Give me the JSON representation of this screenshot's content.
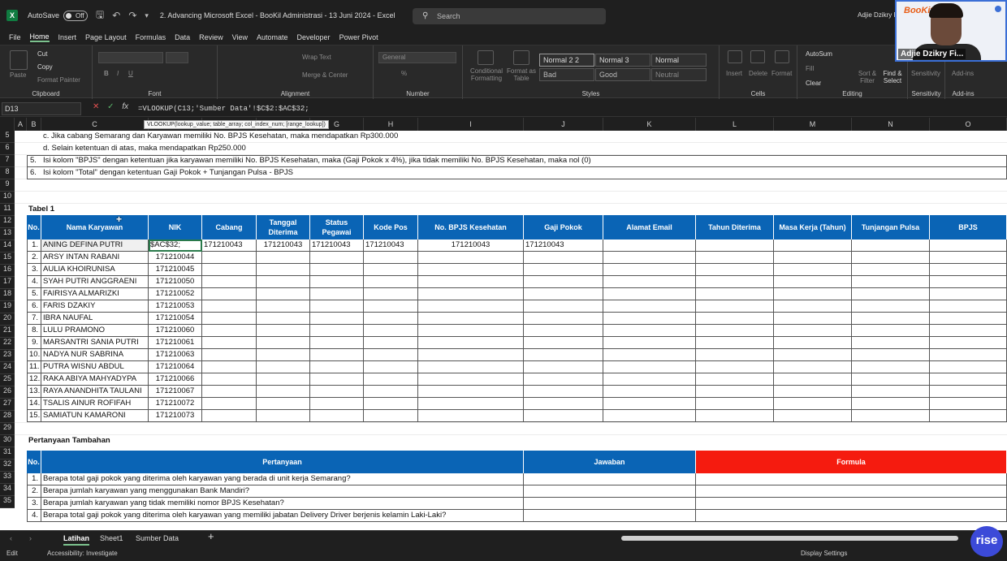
{
  "titlebar": {
    "autosave_label": "AutoSave",
    "autosave_state": "Off",
    "doc_title": "2. Advancing Microsoft Excel - BooKil Administrasi - 13 Juni 2024  -  Excel",
    "search_placeholder": "Search",
    "user_name": "Adjie Dzikry F"
  },
  "webcam": {
    "logo": "BooKit",
    "name": "Adjie Dzikry Fi..."
  },
  "menu": [
    "File",
    "Home",
    "Insert",
    "Page Layout",
    "Formulas",
    "Data",
    "Review",
    "View",
    "Automate",
    "Developer",
    "Power Pivot"
  ],
  "ribbon": {
    "clipboard": {
      "paste": "Paste",
      "cut": "Cut",
      "copy": "Copy",
      "format_painter": "Format Painter",
      "label": "Clipboard"
    },
    "font": {
      "label": "Font",
      "bold": "B",
      "italic": "I",
      "underline": "U"
    },
    "alignment": {
      "wrap": "Wrap Text",
      "merge": "Merge & Center",
      "label": "Alignment"
    },
    "number": {
      "format": "General",
      "label": "Number",
      "percent": "%",
      "comma": "9"
    },
    "styles": {
      "conditional": "Conditional Formatting",
      "format_table": "Format as Table",
      "cells": [
        "Normal 2 2",
        "Normal 3",
        "Normal",
        "Bad",
        "Good",
        "Neutral"
      ],
      "label": "Styles"
    },
    "cells": {
      "insert": "Insert",
      "delete": "Delete",
      "format": "Format",
      "label": "Cells"
    },
    "editing": {
      "autosum": "AutoSum",
      "fill": "Fill",
      "clear": "Clear",
      "sort": "Sort & Filter",
      "find": "Find & Select",
      "label": "Editing"
    },
    "sensitivity": {
      "btn": "Sensitivity",
      "label": "Sensitivity"
    },
    "addins": {
      "btn": "Add-ins",
      "label": "Add-ins"
    }
  },
  "formula_bar": {
    "name_box": "D13",
    "formula": "=VLOOKUP(C13;'Sumber Data'!$C$2:$AC$32;",
    "tooltip": "VLOOKUP(lookup_value; table_array; col_index_num; [range_lookup])"
  },
  "columns": [
    "A",
    "B",
    "C",
    "D",
    "E",
    "F",
    "G",
    "H",
    "I",
    "J",
    "K",
    "L",
    "M",
    "N",
    "O"
  ],
  "rows": [
    "5",
    "6",
    "7",
    "8",
    "9",
    "10",
    "11",
    "12",
    "13",
    "14",
    "15",
    "16",
    "17",
    "18",
    "19",
    "20",
    "21",
    "22",
    "23",
    "24",
    "25",
    "26",
    "27",
    "28",
    "29",
    "30",
    "31",
    "32",
    "33",
    "34",
    "35"
  ],
  "notes": [
    {
      "num": "",
      "text": "c. Jika cabang Semarang dan Karyawan memiliki No. BPJS Kesehatan, maka mendapatkan Rp300.000"
    },
    {
      "num": "",
      "text": "d. Selain ketentuan di atas, maka mendapatkan Rp250.000"
    },
    {
      "num": "5.",
      "text": "Isi kolom \"BPJS\" dengan ketentuan jika karyawan memiliki No. BPJS Kesehatan, maka (Gaji Pokok x 4%), jika tidak memiliki No. BPJS Kesehatan, maka nol (0)"
    },
    {
      "num": "6.",
      "text": "Isi kolom \"Total\" dengan ketentuan Gaji Pokok + Tunjangan Pulsa - BPJS"
    }
  ],
  "table1": {
    "title": "Tabel 1",
    "headers": [
      "No.",
      "Nama Karyawan",
      "NIK",
      "Cabang",
      "Tanggal Diterima",
      "Status Pegawai",
      "Kode Pos",
      "No. BPJS Kesehatan",
      "Gaji Pokok",
      "Alamat Email",
      "Tahun Diterima",
      "Masa Kerja (Tahun)",
      "Tunjangan Pulsa",
      "BPJS"
    ],
    "row1_extra": {
      "nik_editing": "$AC$32;",
      "cabang": "171210043",
      "tanggal": "171210043",
      "status": "171210043",
      "kodepos": "171210043",
      "bpjs_no": "171210043",
      "gaji": "171210043"
    },
    "rows": [
      {
        "no": "1.",
        "name": "ANING DEFINA PUTRI",
        "nik": ""
      },
      {
        "no": "2.",
        "name": "ARSY INTAN RABANI",
        "nik": "171210044"
      },
      {
        "no": "3.",
        "name": "AULIA KHOIRUNISA",
        "nik": "171210045"
      },
      {
        "no": "4.",
        "name": "SYAH PUTRI ANGGRAENI",
        "nik": "171210050"
      },
      {
        "no": "5.",
        "name": "FAIRISYA ALMARIZKI",
        "nik": "171210052"
      },
      {
        "no": "6.",
        "name": "FARIS DZAKIY",
        "nik": "171210053"
      },
      {
        "no": "7.",
        "name": "IBRA NAUFAL",
        "nik": "171210054"
      },
      {
        "no": "8.",
        "name": "LULU PRAMONO",
        "nik": "171210060"
      },
      {
        "no": "9.",
        "name": "MARSANTRI SANIA PUTRI",
        "nik": "171210061"
      },
      {
        "no": "10.",
        "name": "NADYA NUR SABRINA",
        "nik": "171210063"
      },
      {
        "no": "11.",
        "name": "PUTRA WISNU ABDUL",
        "nik": "171210064"
      },
      {
        "no": "12.",
        "name": "RAKA ABIYA MAHYADYPA",
        "nik": "171210066"
      },
      {
        "no": "13.",
        "name": "RAYA ANANDHITA TAULANI",
        "nik": "171210067"
      },
      {
        "no": "14.",
        "name": "TSALIS AINUR ROFIFAH",
        "nik": "171210072"
      },
      {
        "no": "15.",
        "name": "SAMIATUN KAMARONI",
        "nik": "171210073"
      }
    ]
  },
  "table2": {
    "title": "Pertanyaan Tambahan",
    "headers": [
      "No.",
      "Pertanyaan",
      "Jawaban",
      "Formula"
    ],
    "rows": [
      {
        "no": "1.",
        "q": "Berapa total gaji pokok yang diterima oleh karyawan yang berada di unit kerja Semarang?"
      },
      {
        "no": "2.",
        "q": "Berapa jumlah karyawan yang menggunakan Bank Mandiri?"
      },
      {
        "no": "3.",
        "q": "Berapa jumlah karyawan yang tidak memiliki nomor BPJS Kesehatan?"
      },
      {
        "no": "4.",
        "q": "Berapa total gaji pokok yang diterima oleh karyawan yang memiliki jabatan Delivery Driver berjenis kelamin Laki-Laki?"
      }
    ]
  },
  "sheets": [
    "Latihan",
    "Sheet1",
    "Sumber Data"
  ],
  "status": {
    "mode": "Edit",
    "accessibility": "Accessibility: Investigate",
    "display": "Display Settings"
  },
  "rise_logo": "rise"
}
